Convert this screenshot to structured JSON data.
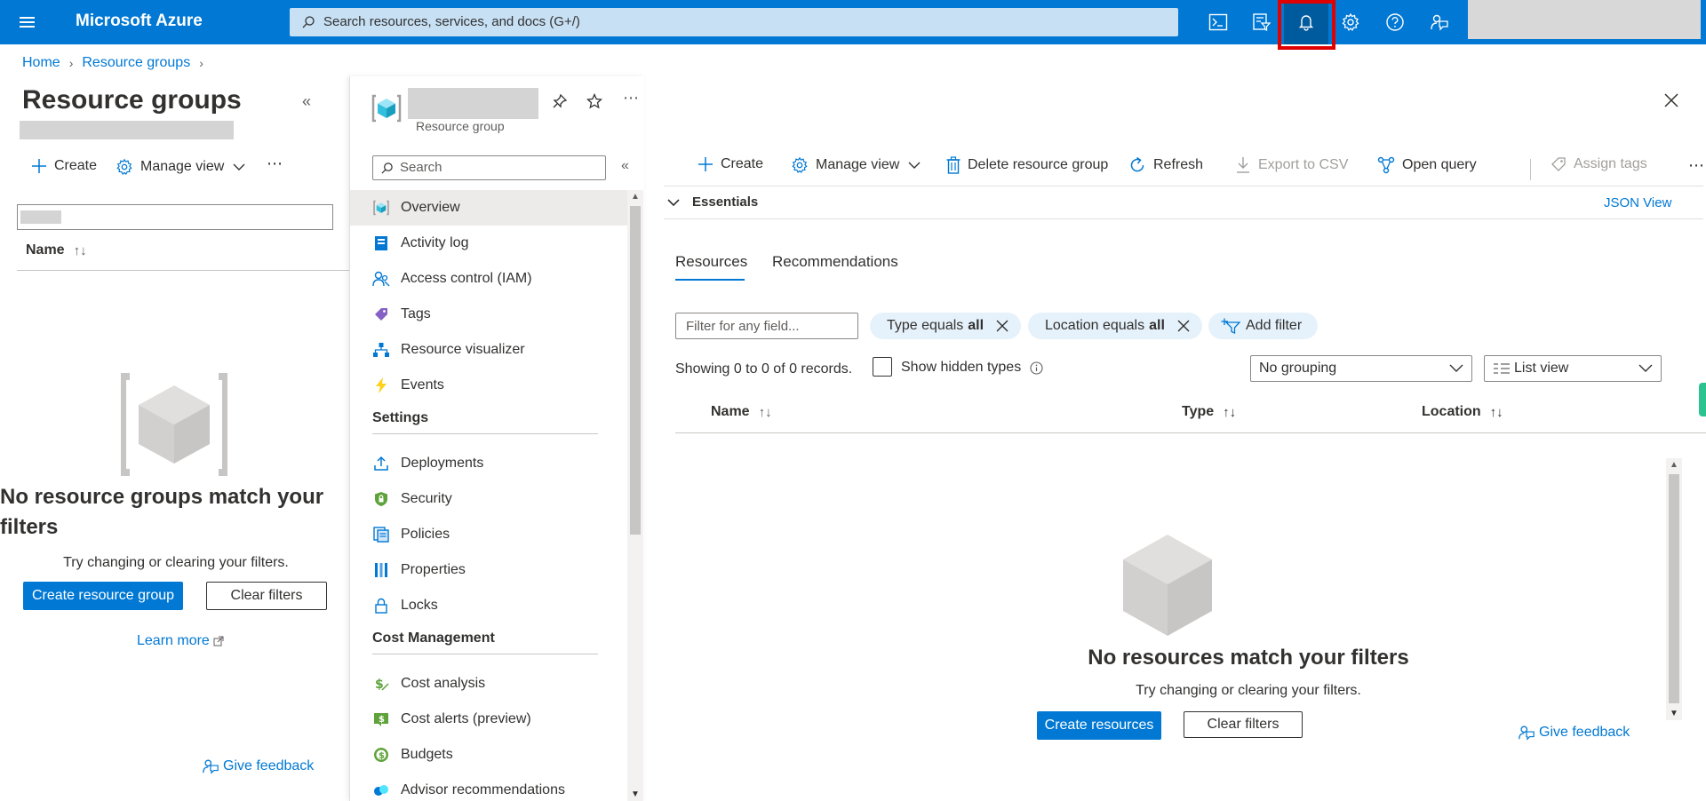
{
  "topbar": {
    "brand": "Microsoft Azure",
    "search_placeholder": "Search resources, services, and docs (G+/)",
    "icons": [
      "cloud-shell-icon",
      "directory-filter-icon",
      "notifications-icon",
      "settings-icon",
      "help-icon",
      "feedback-icon"
    ],
    "accent_color": "#0078d4",
    "active_icon": "notifications-icon"
  },
  "breadcrumb": {
    "items": [
      "Home",
      "Resource groups"
    ]
  },
  "left": {
    "title": "Resource groups",
    "commands": {
      "create": "Create",
      "manage_view": "Manage view"
    },
    "column_name": "Name",
    "empty_title": "No resource groups match your filters",
    "empty_sub": "Try changing or clearing your filters.",
    "create_button": "Create resource group",
    "clear_button": "Clear filters",
    "learn_more": "Learn more",
    "give_feedback": "Give feedback"
  },
  "nav": {
    "subtitle": "Resource group",
    "search_placeholder": "Search",
    "items_top": [
      "Overview",
      "Activity log",
      "Access control (IAM)",
      "Tags",
      "Resource visualizer",
      "Events"
    ],
    "section_settings": "Settings",
    "items_settings": [
      "Deployments",
      "Security",
      "Policies",
      "Properties",
      "Locks"
    ],
    "section_cost": "Cost Management",
    "items_cost": [
      "Cost analysis",
      "Cost alerts (preview)",
      "Budgets",
      "Advisor recommendations"
    ]
  },
  "main": {
    "commands": {
      "create": "Create",
      "manage_view": "Manage view",
      "delete": "Delete resource group",
      "refresh": "Refresh",
      "export": "Export to CSV",
      "open_query": "Open query",
      "assign_tags": "Assign tags"
    },
    "essentials": "Essentials",
    "json_view": "JSON View",
    "tabs": [
      "Resources",
      "Recommendations"
    ],
    "filter_placeholder": "Filter for any field...",
    "pill_type": {
      "label": "Type equals",
      "value": "all"
    },
    "pill_location": {
      "label": "Location equals",
      "value": "all"
    },
    "add_filter": "Add filter",
    "showing": "Showing 0 to 0 of 0 records.",
    "show_hidden": "Show hidden types",
    "grouping": "No grouping",
    "view": "List view",
    "columns": [
      "Name",
      "Type",
      "Location"
    ],
    "empty_title": "No resources match your filters",
    "empty_sub": "Try changing or clearing your filters.",
    "create_button": "Create resources",
    "clear_button": "Clear filters",
    "give_feedback": "Give feedback"
  }
}
